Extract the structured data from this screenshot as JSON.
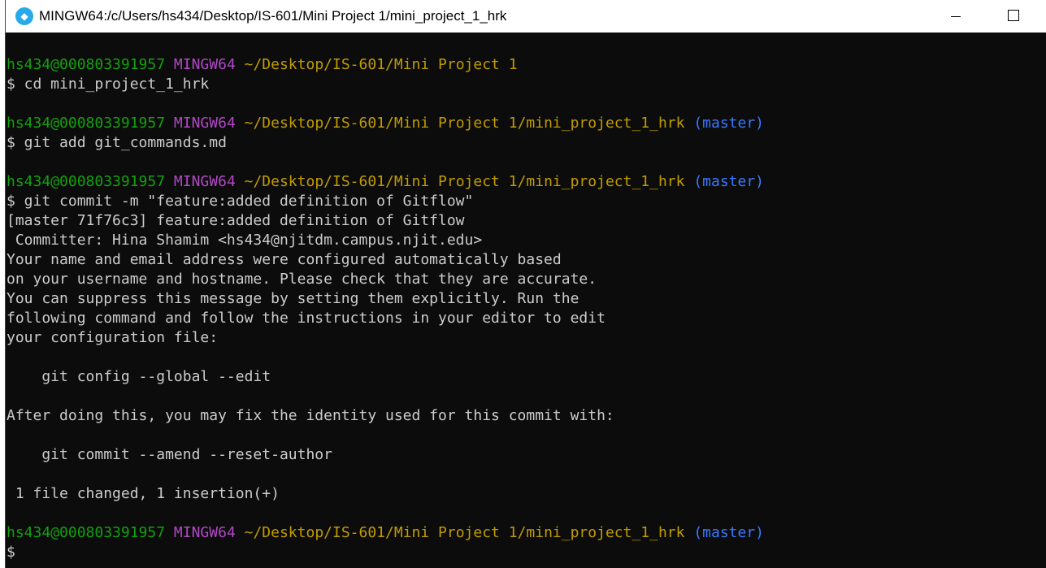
{
  "window": {
    "title": "MINGW64:/c/Users/hs434/Desktop/IS-601/Mini Project 1/mini_project_1_hrk",
    "icon": "git-bash-icon"
  },
  "terminal": {
    "lines": [
      {
        "type": "blank",
        "text": ""
      },
      {
        "type": "prompt",
        "user": "hs434@000803391957",
        "host": "MINGW64",
        "path": "~/Desktop/IS-601/Mini Project 1",
        "branch": ""
      },
      {
        "type": "text",
        "text": "$ cd mini_project_1_hrk"
      },
      {
        "type": "blank",
        "text": ""
      },
      {
        "type": "prompt",
        "user": "hs434@000803391957",
        "host": "MINGW64",
        "path": "~/Desktop/IS-601/Mini Project 1/mini_project_1_hrk",
        "branch": "(master)"
      },
      {
        "type": "text",
        "text": "$ git add git_commands.md"
      },
      {
        "type": "blank",
        "text": ""
      },
      {
        "type": "prompt",
        "user": "hs434@000803391957",
        "host": "MINGW64",
        "path": "~/Desktop/IS-601/Mini Project 1/mini_project_1_hrk",
        "branch": "(master)"
      },
      {
        "type": "text",
        "text": "$ git commit -m \"feature:added definition of Gitflow\""
      },
      {
        "type": "text",
        "text": "[master 71f76c3] feature:added definition of Gitflow"
      },
      {
        "type": "text",
        "text": " Committer: Hina Shamim <hs434@njitdm.campus.njit.edu>"
      },
      {
        "type": "text",
        "text": "Your name and email address were configured automatically based"
      },
      {
        "type": "text",
        "text": "on your username and hostname. Please check that they are accurate."
      },
      {
        "type": "text",
        "text": "You can suppress this message by setting them explicitly. Run the"
      },
      {
        "type": "text",
        "text": "following command and follow the instructions in your editor to edit"
      },
      {
        "type": "text",
        "text": "your configuration file:"
      },
      {
        "type": "blank",
        "text": ""
      },
      {
        "type": "text",
        "text": "    git config --global --edit"
      },
      {
        "type": "blank",
        "text": ""
      },
      {
        "type": "text",
        "text": "After doing this, you may fix the identity used for this commit with:"
      },
      {
        "type": "blank",
        "text": ""
      },
      {
        "type": "text",
        "text": "    git commit --amend --reset-author"
      },
      {
        "type": "blank",
        "text": ""
      },
      {
        "type": "text",
        "text": " 1 file changed, 1 insertion(+)"
      },
      {
        "type": "blank",
        "text": ""
      },
      {
        "type": "prompt",
        "user": "hs434@000803391957",
        "host": "MINGW64",
        "path": "~/Desktop/IS-601/Mini Project 1/mini_project_1_hrk",
        "branch": "(master)"
      },
      {
        "type": "text",
        "text": "$"
      }
    ]
  },
  "colors": {
    "user": "#13a10e",
    "host": "#b148c6",
    "path": "#c19c00",
    "branch": "#3b78ff",
    "text": "#cccccc",
    "background": "#0c0c0c"
  }
}
